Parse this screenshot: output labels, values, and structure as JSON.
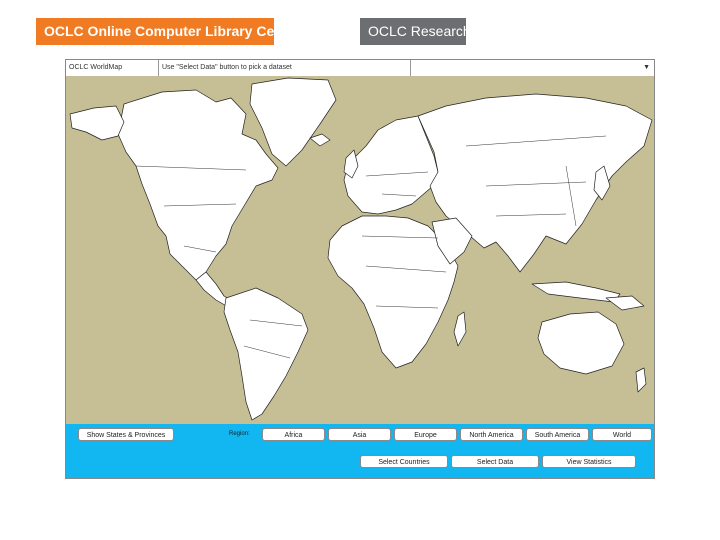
{
  "branding": {
    "oclc": "OCLC Online Computer Library Center",
    "research": "OCLC Research"
  },
  "app": {
    "title": "OCLC WorldMap",
    "message": "Use \"Select Data\" button to pick a dataset",
    "dataset_value": "",
    "dropdown_icon": "triangle-down"
  },
  "colors": {
    "oclc_orange": "#f07b22",
    "research_gray": "#6d6e71",
    "ocean": "#c6be94",
    "land": "#ffffff",
    "toolbar": "#12b6f0"
  },
  "toolbar": {
    "show_states": "Show States & Provinces",
    "region_label": "Region:",
    "regions": [
      "Africa",
      "Asia",
      "Europe",
      "North America",
      "South America",
      "World"
    ],
    "select_countries": "Select Countries",
    "select_data": "Select Data",
    "view_statistics": "View Statistics"
  }
}
